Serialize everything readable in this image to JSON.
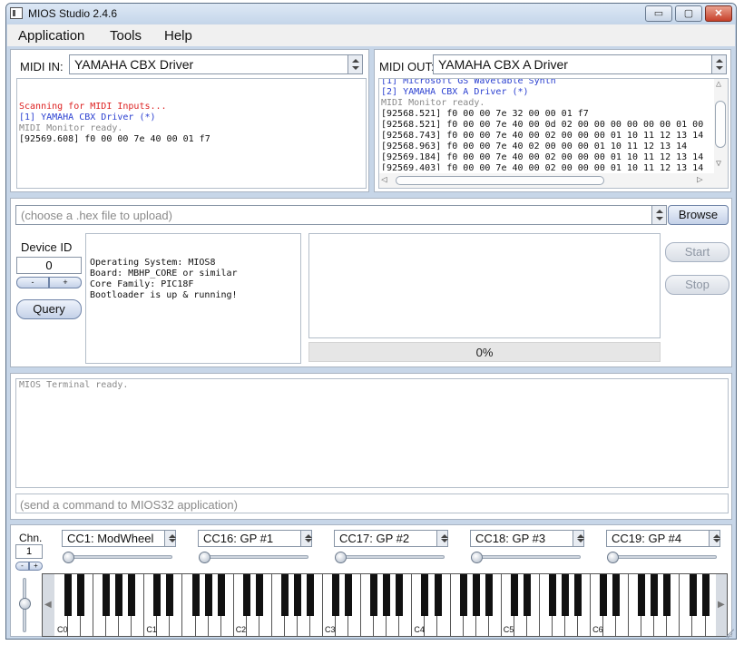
{
  "window": {
    "title": "MIOS Studio 2.4.6",
    "minimize_glyph": "▭",
    "maximize_glyph": "▢",
    "close_glyph": "✕"
  },
  "menu": [
    "Application",
    "Tools",
    "Help"
  ],
  "midi_in": {
    "label": "MIDI IN:",
    "device": "YAMAHA CBX Driver",
    "log": [
      {
        "text": "Scanning for MIDI Inputs...",
        "color": "red"
      },
      {
        "text": "[1] YAMAHA CBX Driver (*)",
        "color": "blue"
      },
      {
        "text": "MIDI Monitor ready.",
        "color": "gray"
      },
      {
        "text": "[92569.608] f0 00 00 7e 40 00 01 f7",
        "color": "black"
      }
    ]
  },
  "midi_out": {
    "label": "MIDI OUT:",
    "device": "YAMAHA CBX A Driver",
    "log": [
      {
        "text": "[1] Microsoft GS Wavetable Synth",
        "color": "blue"
      },
      {
        "text": "[2] YAMAHA CBX A Driver (*)",
        "color": "blue"
      },
      {
        "text": "MIDI Monitor ready.",
        "color": "gray"
      },
      {
        "text": "[92568.521] f0 00 00 7e 32 00 00 01 f7",
        "color": "black"
      },
      {
        "text": "[92568.521] f0 00 00 7e 40 00 0d 02 00 00 00 00 00 00 01 00",
        "color": "black"
      },
      {
        "text": "[92568.743] f0 00 00 7e 40 00 02 00 00 00 01 10 11 12 13 14",
        "color": "black"
      },
      {
        "text": "[92568.963] f0 00 00 7e 40 02 00 00 00 01 10 11 12 13 14",
        "color": "black"
      },
      {
        "text": "[92569.184] f0 00 00 7e 40 00 02 00 00 00 01 10 11 12 13 14",
        "color": "black"
      },
      {
        "text": "[92569.403] f0 00 00 7e 40 00 02 00 00 00 01 10 11 12 13 14",
        "color": "black"
      }
    ]
  },
  "upload": {
    "placeholder": "(choose a .hex file to upload)",
    "browse_label": "Browse"
  },
  "device": {
    "label": "Device ID",
    "id_value": "0",
    "dec_label": "-",
    "inc_label": "+",
    "query_label": "Query",
    "info": [
      "Operating System: MIOS8",
      "Board: MBHP_CORE or similar",
      "Core Family: PIC18F",
      "Bootloader is up & running!"
    ]
  },
  "progress": {
    "percent_label": "0%",
    "fraction": 0.0
  },
  "controls": {
    "start_label": "Start",
    "stop_label": "Stop"
  },
  "terminal": {
    "output": "MIOS Terminal ready.",
    "command_placeholder": "(send a command to MIOS32 application)"
  },
  "keyboard_panel": {
    "chn_label": "Chn.",
    "chn_value": "1",
    "chn_dec": "-",
    "chn_inc": "+",
    "cc": [
      {
        "label": "CC1: ModWheel",
        "value": 0
      },
      {
        "label": "CC16: GP #1",
        "value": 0
      },
      {
        "label": "CC17: GP #2",
        "value": 0
      },
      {
        "label": "CC18: GP #3",
        "value": 0
      },
      {
        "label": "CC19: GP #4",
        "value": 0
      }
    ],
    "octaves": [
      "C0",
      "C1",
      "C2",
      "C3",
      "C4",
      "C5",
      "C6"
    ]
  },
  "icons": {
    "scroll_up": "△",
    "scroll_down": "▽",
    "scroll_left": "◁",
    "scroll_right": "▷",
    "kb_left": "◀",
    "kb_right": "▶"
  }
}
